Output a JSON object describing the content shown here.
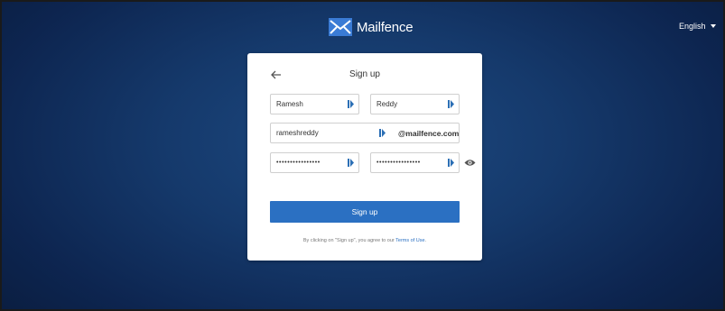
{
  "header": {
    "brand": "Mailfence",
    "language": "English"
  },
  "signup": {
    "title": "Sign up",
    "first_name": "Ramesh",
    "last_name": "Reddy",
    "username": "rameshreddy",
    "domain": "@mailfence.com",
    "password_mask": "••••••••••••••••",
    "confirm_password_mask": "••••••••••••••••",
    "submit_label": "Sign up",
    "terms_prefix": "By clicking on \"Sign up\", you agree to our ",
    "terms_link": "Terms of Use",
    "terms_suffix": "."
  },
  "colors": {
    "accent": "#2b70c2",
    "background": "#15396b",
    "field_icon": "#2b6fb5"
  },
  "icons": {
    "back": "arrow-left-icon",
    "field": "password-manager-icon",
    "eye": "eye-icon",
    "lang": "caret-down-icon"
  }
}
